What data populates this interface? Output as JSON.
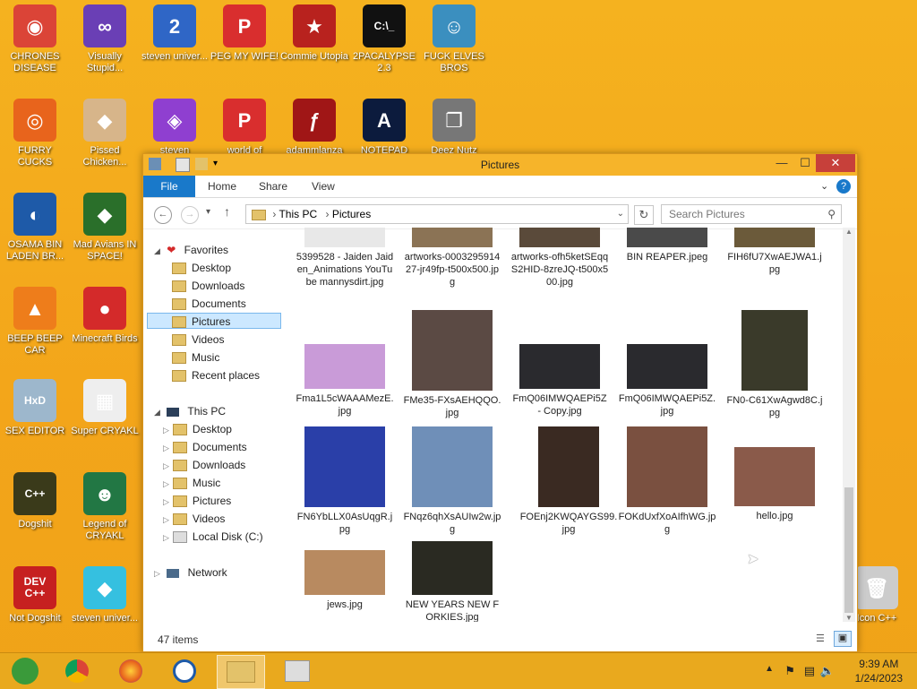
{
  "desktop": {
    "icons": [
      {
        "label": "CHRONES DISEASE",
        "glyph": "◉",
        "color": "#db4437"
      },
      {
        "label": "Visually Stupid...",
        "glyph": "∞",
        "color": "#6a3fb5"
      },
      {
        "label": "steven univer...",
        "glyph": "2",
        "color": "#2f66c6"
      },
      {
        "label": "PEG MY WIFE!",
        "glyph": "P",
        "color": "#d92e2e"
      },
      {
        "label": "Commie Utopia",
        "glyph": "★",
        "color": "#b8221e"
      },
      {
        "label": "2PACALYPSE 2.3",
        "glyph": "C:\\_",
        "color": "#111111"
      },
      {
        "label": "FUCK ELVES BROS",
        "glyph": "☺",
        "color": "#3b8fbf"
      },
      {
        "label": "FURRY CUCKS",
        "glyph": "◎",
        "color": "#e8641c"
      },
      {
        "label": "Pissed Chicken...",
        "glyph": "◆",
        "color": "#d7b58a"
      },
      {
        "label": "steven",
        "glyph": "◈",
        "color": "#8f3fd0"
      },
      {
        "label": "world of",
        "glyph": "P",
        "color": "#d92e2e"
      },
      {
        "label": "adammlanza",
        "glyph": "ƒ",
        "color": "#a01616"
      },
      {
        "label": "NOTEPAD",
        "glyph": "A",
        "color": "#0c1b3d"
      },
      {
        "label": "Deez Nutz",
        "glyph": "❐",
        "color": "#777777"
      },
      {
        "label": "OSAMA BIN LADEN BR...",
        "glyph": "◐",
        "color": "#1e5aa8"
      },
      {
        "label": "Mad Avians IN SPACE!",
        "glyph": "◆",
        "color": "#2a6f2a"
      },
      {
        "label": "BEEP BEEP CAR",
        "glyph": "▲",
        "color": "#ee7d1b"
      },
      {
        "label": "Minecraft Birds",
        "glyph": "●",
        "color": "#d42a2a"
      },
      {
        "label": "SEX EDITOR",
        "glyph": "HxD",
        "color": "#9db7cc"
      },
      {
        "label": "Super CRYAKL",
        "glyph": "▦",
        "color": "#eeeeee"
      },
      {
        "label": "Dogshit",
        "glyph": "C++",
        "color": "#3a3a1a"
      },
      {
        "label": "Legend of CRYAKL",
        "glyph": "☻",
        "color": "#227744"
      },
      {
        "label": "Not Dogshit",
        "glyph": "DEV C++",
        "color": "#c62020"
      },
      {
        "label": "steven univer...",
        "glyph": "◆",
        "color": "#35c0e0"
      },
      {
        "label": "Icon C++",
        "glyph": "🗑",
        "color": "#cccccc"
      }
    ]
  },
  "window": {
    "title": "Pictures",
    "ribbon_tabs": [
      "File",
      "Home",
      "Share",
      "View"
    ],
    "breadcrumb": [
      "This PC",
      "Pictures"
    ],
    "search_placeholder": "Search Pictures",
    "status": "47 items"
  },
  "nav": {
    "favorites": "Favorites",
    "fav_items": [
      "Desktop",
      "Downloads",
      "Documents",
      "Pictures",
      "Videos",
      "Music",
      "Recent places"
    ],
    "thispc": "This PC",
    "pc_items": [
      "Desktop",
      "Documents",
      "Downloads",
      "Music",
      "Pictures",
      "Videos",
      "Local Disk (C:)"
    ],
    "network": "Network"
  },
  "files": [
    {
      "name": "5399528 - Jaiden Jaiden_Animations YouTube mannysdirt.jpg",
      "color": "#e8e8e8"
    },
    {
      "name": "artworks-000329591427-jr49fp-t500x500.jpg",
      "color": "#8b7355"
    },
    {
      "name": "artworks-ofh5ketSEqqS2HID-8zreJQ-t500x500.jpg",
      "color": "#5a4a3a"
    },
    {
      "name": "BIN REAPER.jpeg",
      "color": "#4a4a4a"
    },
    {
      "name": "FIH6fU7XwAEJWA1.jpg",
      "color": "#6b5a3a"
    },
    {
      "name": "Fma1L5cWAAAMezE.jpg",
      "color": "#c99bd8"
    },
    {
      "name": "FMe35-FXsAEHQQO.jpg",
      "color": "#5b4a44"
    },
    {
      "name": "FmQ06IMWQAEPi5Z - Copy.jpg",
      "color": "#2a2a2e"
    },
    {
      "name": "FmQ06IMWQAEPi5Z.jpg",
      "color": "#2a2a2e"
    },
    {
      "name": "FN0-C61XwAgwd8C.jpg",
      "color": "#3a3a2a"
    },
    {
      "name": "FN6YbLLX0AsUqgR.jpg",
      "color": "#2a3fa8"
    },
    {
      "name": "FNqz6qhXsAUIw2w.jpg",
      "color": "#6f8fb8"
    },
    {
      "name": "FOEnj2KWQAYGS99.jpg",
      "color": "#3a2a22"
    },
    {
      "name": "FOKdUxfXoAIfhWG.jpg",
      "color": "#7a5040"
    },
    {
      "name": "hello.jpg",
      "color": "#8a5a4a"
    },
    {
      "name": "jews.jpg",
      "color": "#b88a60"
    },
    {
      "name": "NEW YEARS NEW FORKIES.jpg",
      "color": "#2a2a22"
    }
  ],
  "taskbar": {
    "time": "9:39 AM",
    "date": "1/24/2023"
  }
}
